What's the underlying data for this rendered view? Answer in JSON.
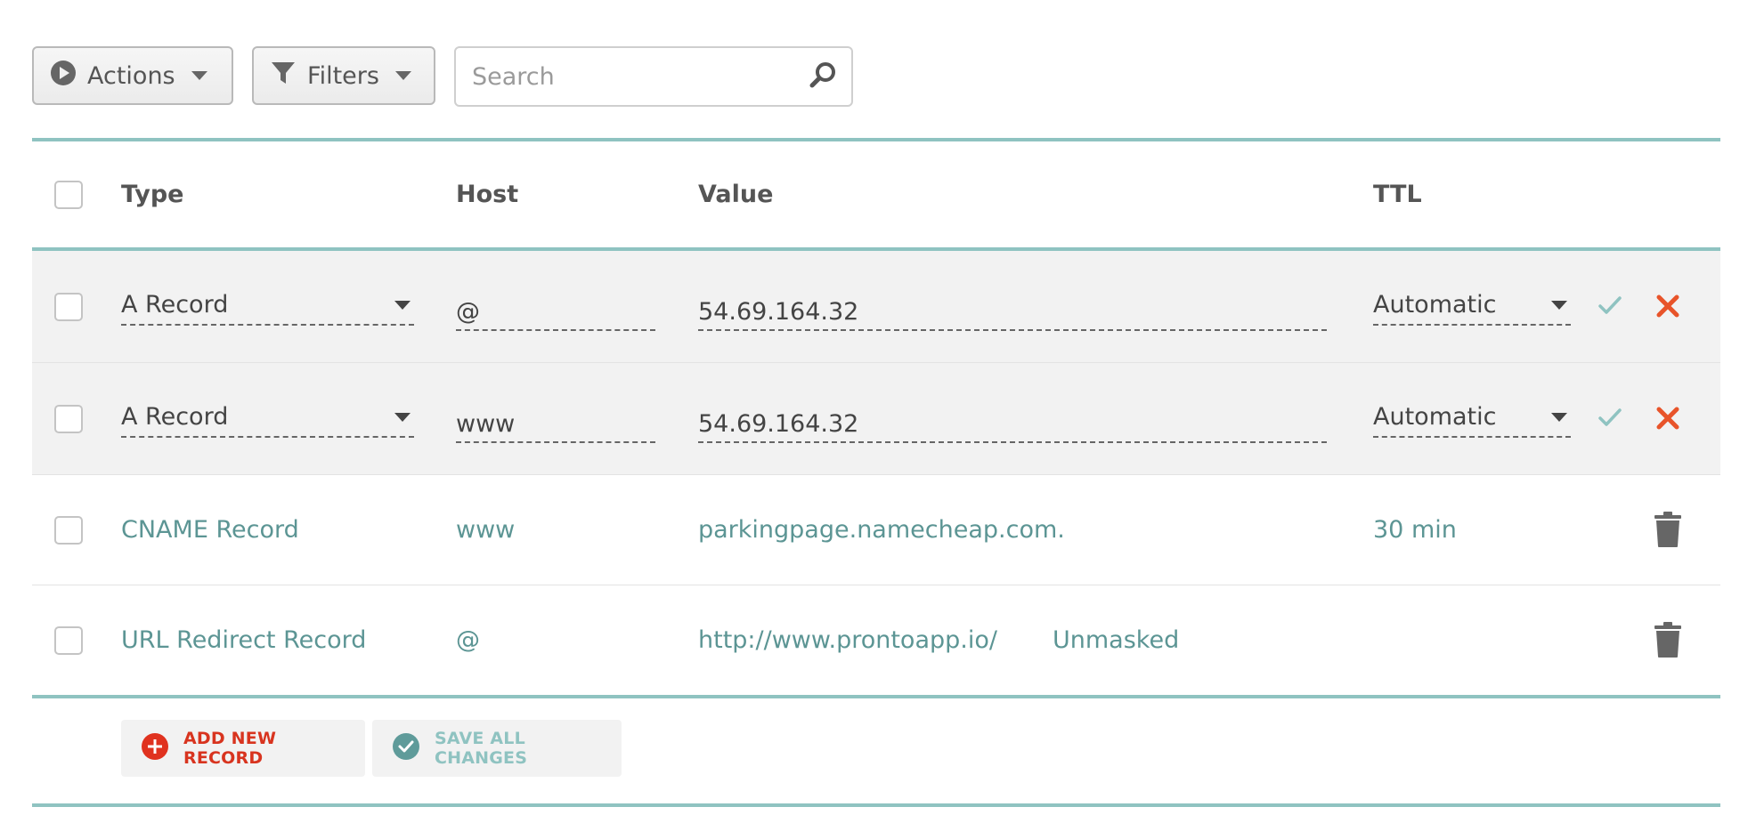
{
  "toolbar": {
    "actions_label": "Actions",
    "filters_label": "Filters",
    "search_placeholder": "Search"
  },
  "table": {
    "columns": {
      "type": "Type",
      "host": "Host",
      "value": "Value",
      "ttl": "TTL"
    },
    "rows": [
      {
        "type": "A Record",
        "host": "@",
        "value": "54.69.164.32",
        "ttl": "Automatic",
        "editing": true
      },
      {
        "type": "A Record",
        "host": "www",
        "value": "54.69.164.32",
        "ttl": "Automatic",
        "editing": true
      },
      {
        "type": "CNAME Record",
        "host": "www",
        "value": "parkingpage.namecheap.com.",
        "ttl": "30 min",
        "editing": false
      },
      {
        "type": "URL Redirect Record",
        "host": "@",
        "value": "http://www.prontoapp.io/",
        "extra": "Unmasked",
        "ttl": "",
        "editing": false
      }
    ]
  },
  "footer": {
    "add_label": "ADD NEW RECORD",
    "save_label": "SAVE ALL CHANGES"
  },
  "icons": {
    "actions": "play-circle-icon",
    "filters": "funnel-icon",
    "search": "search-icon",
    "confirm": "check-icon",
    "cancel": "close-icon",
    "delete": "trash-icon",
    "add": "plus-circle-icon",
    "save": "check-circle-icon"
  },
  "colors": {
    "accent_teal": "#8fc3c1",
    "text_teal": "#5c9594",
    "cancel_red": "#e8542a",
    "add_red": "#d8341f",
    "edit_row_bg": "#f2f2f2"
  }
}
